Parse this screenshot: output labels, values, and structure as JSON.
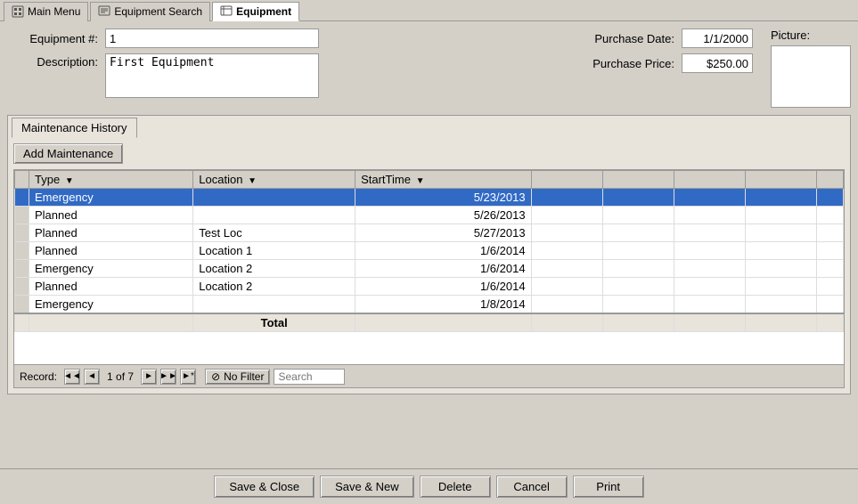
{
  "tabs": [
    {
      "id": "main-menu",
      "label": "Main Menu",
      "icon": "home",
      "active": false
    },
    {
      "id": "equipment-search",
      "label": "Equipment Search",
      "icon": "search",
      "active": false
    },
    {
      "id": "equipment",
      "label": "Equipment",
      "icon": "table",
      "active": true
    }
  ],
  "form": {
    "equipment_number_label": "Equipment #:",
    "equipment_number_value": "1",
    "description_label": "Description:",
    "description_value": "First Equipment",
    "purchase_date_label": "Purchase Date:",
    "purchase_date_value": "1/1/2000",
    "purchase_price_label": "Purchase Price:",
    "purchase_price_value": "$250.00",
    "picture_label": "Picture:"
  },
  "maintenance_tab": {
    "label": "Maintenance History",
    "add_button": "Add Maintenance",
    "columns": [
      {
        "key": "type",
        "label": "Type"
      },
      {
        "key": "location",
        "label": "Location"
      },
      {
        "key": "start_time",
        "label": "StartTime"
      }
    ],
    "rows": [
      {
        "type": "Emergency",
        "location": "",
        "start_time": "5/23/2013",
        "selected": true
      },
      {
        "type": "Planned",
        "location": "",
        "start_time": "5/26/2013",
        "selected": false
      },
      {
        "type": "Planned",
        "location": "Test Loc",
        "start_time": "5/27/2013",
        "selected": false
      },
      {
        "type": "Planned",
        "location": "Location 1",
        "start_time": "1/6/2014",
        "selected": false
      },
      {
        "type": "Emergency",
        "location": "Location 2",
        "start_time": "1/6/2014",
        "selected": false
      },
      {
        "type": "Planned",
        "location": "Location 2",
        "start_time": "1/6/2014",
        "selected": false
      },
      {
        "type": "Emergency",
        "location": "",
        "start_time": "1/8/2014",
        "selected": false
      }
    ],
    "total_row_label": "Total"
  },
  "record_bar": {
    "label": "Record:",
    "first_icon": "◄◄",
    "prev_icon": "◄",
    "record_info": "1 of 7",
    "next_icon": "►",
    "last_icon": "►►",
    "new_icon": "►*",
    "filter_label": "No Filter",
    "search_placeholder": "Search"
  },
  "bottom_buttons": [
    {
      "id": "save-close",
      "label": "Save & Close"
    },
    {
      "id": "save-new",
      "label": "Save & New"
    },
    {
      "id": "delete",
      "label": "Delete"
    },
    {
      "id": "cancel",
      "label": "Cancel"
    },
    {
      "id": "print",
      "label": "Print"
    }
  ]
}
